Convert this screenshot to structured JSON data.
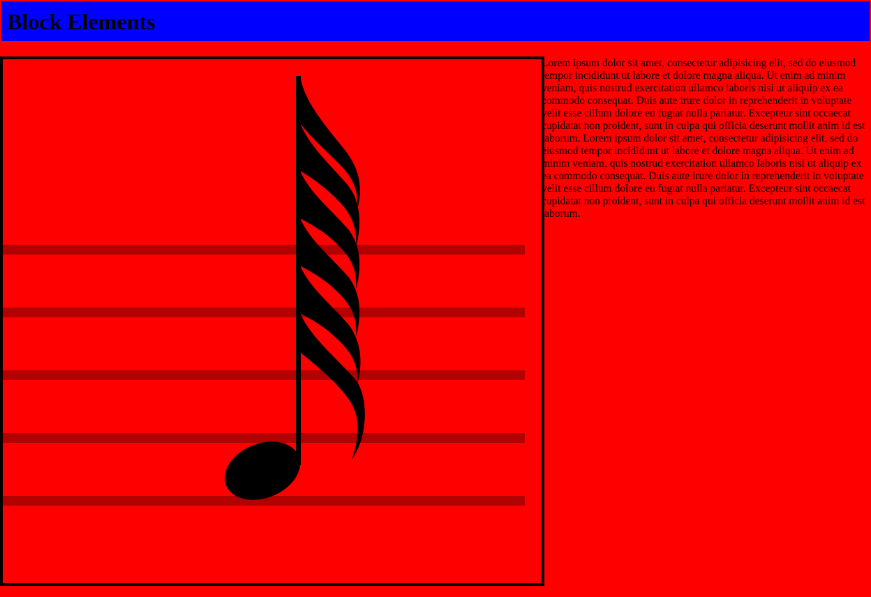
{
  "header": {
    "title": "Block Elements",
    "background": "#0000ff"
  },
  "page": {
    "background": "#ff0000"
  },
  "figure": {
    "icon": "sixty-fourth-note-icon",
    "staff_line_count": 5,
    "staff_color": "#b30000",
    "note_color": "#000000"
  },
  "body_text": "Lorem ipsum dolor sit amet, consectetur adipisicing elit, sed do eiusmod tempor incididunt ut labore et dolore magna aliqua. Ut enim ad minim veniam, quis nostrud exercitation ullamco laboris nisi ut aliquip ex ea commodo consequat. Duis aute irure dolor in reprehenderit in voluptate velit esse cillum dolore eu fugiat nulla pariatur. Excepteur sint occaecat cupidatat non proident, sunt in culpa qui officia deserunt mollit anim id est laborum. Lorem ipsum dolor sit amet, consectetur adipisicing elit, sed do eiusmod tempor incididunt ut labore et dolore magna aliqua. Ut enim ad minim veniam, quis nostrud exercitation ullamco laboris nisi ut aliquip ex ea commodo consequat. Duis aute irure dolor in reprehenderit in voluptate velit esse cillum dolore eu fugiat nulla pariatur. Excepteur sint occaecat cupidatat non proident, sunt in culpa qui officia deserunt mollit anim id est laborum."
}
